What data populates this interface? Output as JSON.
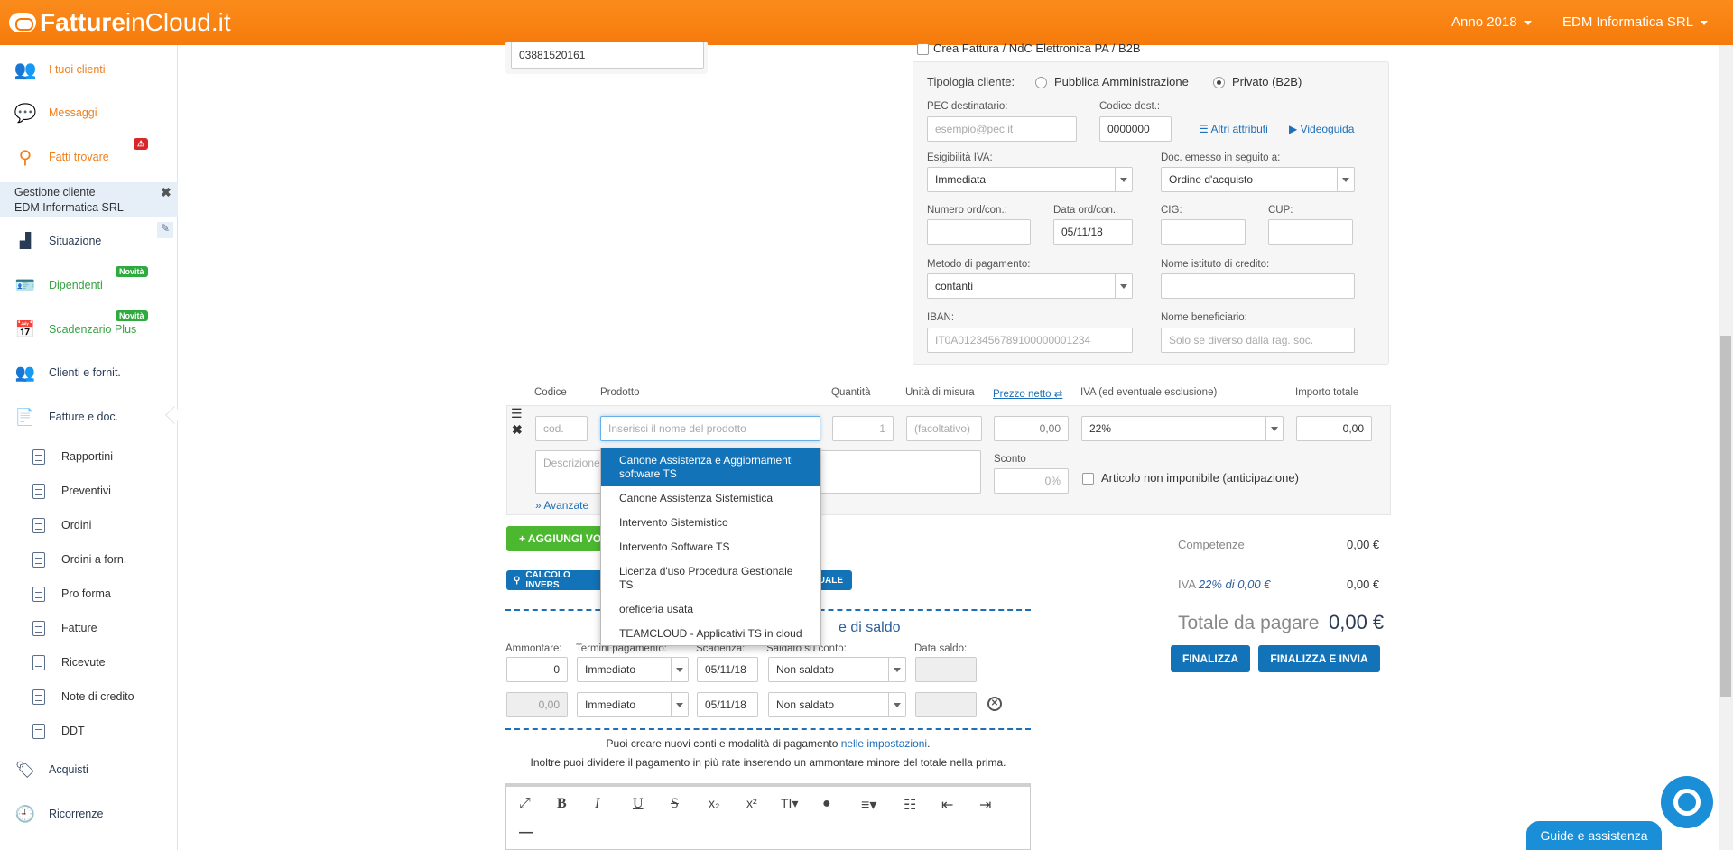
{
  "topbar": {
    "brand_bold": "Fatture",
    "brand_light": "inCloud.it",
    "year": "Anno 2018",
    "company": "EDM Informatica SRL"
  },
  "sidebar": {
    "top": [
      {
        "label": "I tuoi clienti",
        "icon": "users-icon"
      },
      {
        "label": "Messaggi",
        "icon": "chat-icon"
      },
      {
        "label": "Fatti trovare",
        "icon": "search-icon"
      }
    ],
    "client_box": {
      "title": "Gestione cliente",
      "name": "EDM Informatica SRL"
    },
    "items": [
      {
        "label": "Situazione",
        "icon": "bar-chart-icon"
      },
      {
        "label": "Dipendenti",
        "icon": "id-card-icon",
        "badge": "Novità"
      },
      {
        "label": "Scadenzario Plus",
        "icon": "calendar-icon",
        "badge": "Novità"
      },
      {
        "label": "Clienti e fornit.",
        "icon": "people-icon"
      },
      {
        "label": "Fatture e doc.",
        "icon": "document-icon"
      }
    ],
    "subitems": [
      "Rapportini",
      "Preventivi",
      "Ordini",
      "Ordini a forn.",
      "Pro forma",
      "Fatture",
      "Ricevute",
      "Note di credito",
      "DDT"
    ],
    "bottom": [
      {
        "label": "Acquisti",
        "icon": "tags-icon"
      },
      {
        "label": "Ricorrenze",
        "icon": "clock-icon"
      }
    ]
  },
  "form": {
    "piva_value": "03881520161",
    "einvoice_label": "Crea Fattura / NdC Elettronica PA / B2B",
    "tipologia_label": "Tipologia cliente:",
    "tipologia_pa": "Pubblica Amministrazione",
    "tipologia_b2b": "Privato (B2B)",
    "pec_label": "PEC destinatario:",
    "pec_placeholder": "esempio@pec.it",
    "codice_dest_label": "Codice dest.:",
    "codice_dest_value": "0000000",
    "altri_attributi": "Altri attributi",
    "videoguida": "Videoguida",
    "esigibilita_label": "Esigibilità IVA:",
    "esigibilita_value": "Immediata",
    "doc_emesso_label": "Doc. emesso in seguito a:",
    "doc_emesso_value": "Ordine d'acquisto",
    "numero_ord_label": "Numero ord/con.:",
    "data_ord_label": "Data ord/con.:",
    "data_ord_value": "05/11/18",
    "cig_label": "CIG:",
    "cup_label": "CUP:",
    "metodo_label": "Metodo di pagamento:",
    "metodo_value": "contanti",
    "istituto_label": "Nome istituto di credito:",
    "iban_label": "IBAN:",
    "iban_placeholder": "IT0A0123456789100000001234",
    "beneficiario_label": "Nome beneficiario:",
    "beneficiario_placeholder": "Solo se diverso dalla rag. soc."
  },
  "items_table": {
    "headers": {
      "codice": "Codice",
      "prodotto": "Prodotto",
      "quantita": "Quantità",
      "unita": "Unità di misura",
      "prezzo": "Prezzo netto ⇄",
      "iva": "IVA (ed eventuale esclusione)",
      "importo": "Importo totale"
    },
    "codice_placeholder": "cod.",
    "prodotto_placeholder": "Inserisci il nome del prodotto",
    "quantita_value": "1",
    "unita_placeholder": "(facoltativo)",
    "prezzo_value": "0,00",
    "iva_value": "22%",
    "importo_value": "0,00",
    "descrizione_placeholder": "Descrizione",
    "sconto_label": "Sconto",
    "sconto_placeholder": "0%",
    "non_imponibile_label": "Articolo non imponibile (anticipazione)",
    "avanzate": "» Avanzate"
  },
  "dropdown": [
    "Canone Assistenza e Aggiornamenti software TS",
    "Canone Assistenza Sistemistica",
    "Intervento Sistemistico",
    "Intervento Software TS",
    "Licenza d'uso Procedura Gestionale TS",
    "oreficeria usata",
    "TEAMCLOUD - Applicativi TS in cloud"
  ],
  "buttons": {
    "aggiungi": "+ AGGIUNGI VO",
    "calcolo": "CALCOLO INVERS",
    "manuale": "UALE",
    "finalizza": "FINALIZZA",
    "finalizza_invia": "FINALIZZA E INVIA"
  },
  "saldo": {
    "title_fragment": "e di saldo"
  },
  "payments": {
    "headers": {
      "ammontare": "Ammontare:",
      "termini": "Termini pagamento:",
      "scadenza": "Scadenza:",
      "saldato": "Saldato su conto:",
      "data_saldo": "Data saldo:"
    },
    "rows": [
      {
        "ammontare": "0",
        "termini": "Immediato",
        "scadenza": "05/11/18",
        "saldato": "Non saldato"
      },
      {
        "ammontare": "0,00",
        "termini": "Immediato",
        "scadenza": "05/11/18",
        "saldato": "Non saldato"
      }
    ],
    "note_line1_pre": "Puoi creare nuovi conti e modalità di pagamento ",
    "note_line1_link": "nelle impostazioni",
    "note_line1_post": ".",
    "note_line2": "Inoltre puoi dividere il pagamento in più rate inserendo un ammontare minore del totale nella prima."
  },
  "totals": {
    "competenze_label": "Competenze",
    "competenze_value": "0,00 €",
    "iva_label_pre": "IVA",
    "iva_label_rate": "22% di 0,00 €",
    "iva_value": "0,00 €",
    "totale_label": "Totale da pagare",
    "totale_value": "0,00 €"
  },
  "help": {
    "guide": "Guide e assistenza"
  }
}
